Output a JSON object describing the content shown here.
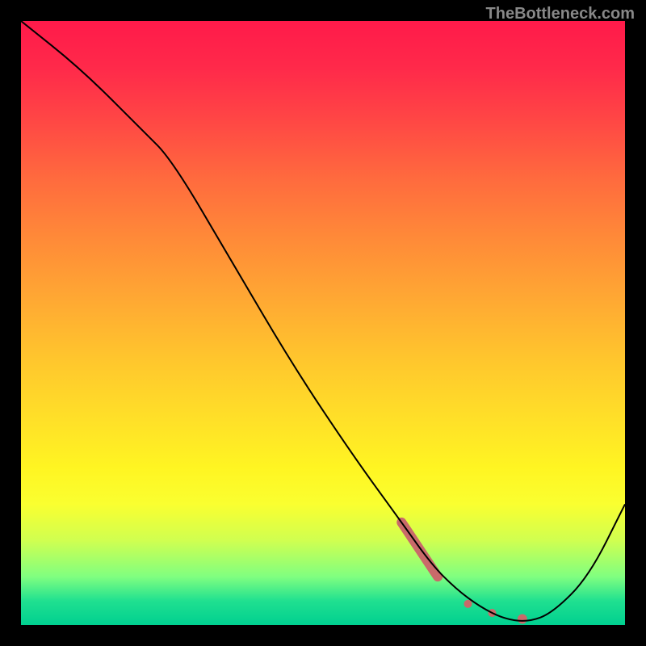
{
  "watermark": "TheBottleneck.com",
  "chart_data": {
    "type": "line",
    "title": "",
    "xlabel": "",
    "ylabel": "",
    "xlim": [
      0,
      100
    ],
    "ylim": [
      0,
      100
    ],
    "series": [
      {
        "name": "bottleneck-curve",
        "x": [
          0,
          10,
          20,
          25,
          35,
          45,
          55,
          63,
          68,
          72,
          76,
          80,
          84,
          88,
          94,
          100
        ],
        "y": [
          100,
          92,
          82,
          77,
          60,
          43,
          28,
          17,
          10,
          6,
          3,
          1,
          0.5,
          2,
          8,
          20
        ],
        "stroke": "#000000",
        "stroke_width": 2
      }
    ],
    "markers": [
      {
        "name": "highlight-band",
        "shape": "thick-line",
        "color": "#c96a6a",
        "x0": 63,
        "y0": 17,
        "x1": 69,
        "y1": 8,
        "width": 12
      },
      {
        "name": "dot-1",
        "shape": "circle",
        "color": "#c96a6a",
        "x": 74,
        "y": 3.5,
        "r": 5
      },
      {
        "name": "dot-2",
        "shape": "circle",
        "color": "#c96a6a",
        "x": 78,
        "y": 2.0,
        "r": 5
      },
      {
        "name": "dot-3",
        "shape": "circle",
        "color": "#c96a6a",
        "x": 83,
        "y": 1.0,
        "r": 6
      }
    ],
    "background": {
      "type": "vertical-gradient",
      "stops": [
        {
          "pos": 0.0,
          "color": "#ff1a4a"
        },
        {
          "pos": 0.5,
          "color": "#ffb030"
        },
        {
          "pos": 0.8,
          "color": "#faff30"
        },
        {
          "pos": 1.0,
          "color": "#00d090"
        }
      ]
    }
  }
}
